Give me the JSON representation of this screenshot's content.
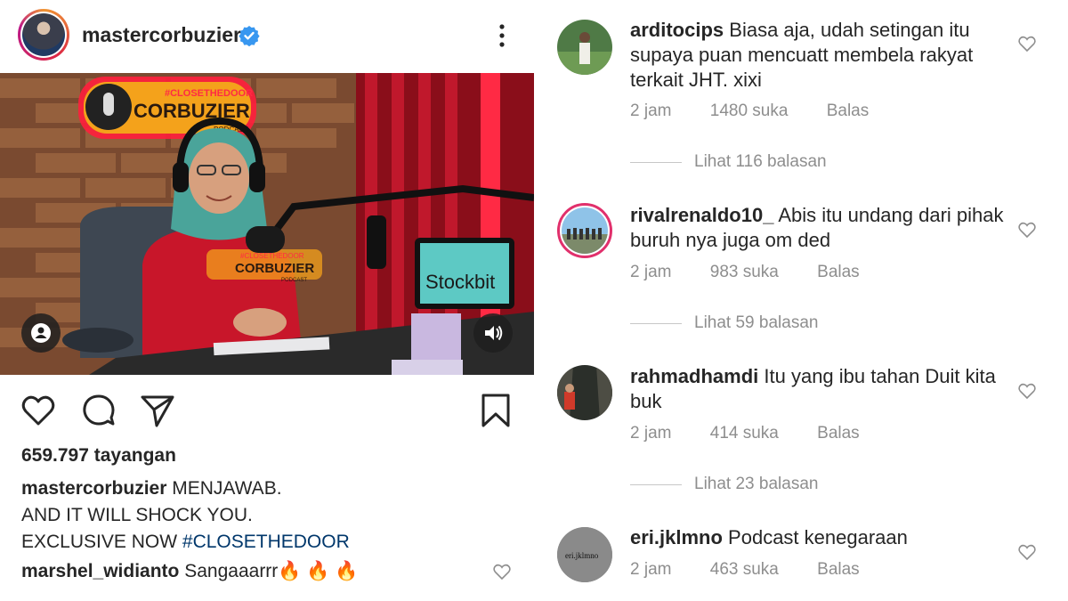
{
  "post": {
    "username": "mastercorbuzier",
    "verified": true,
    "menu_icon": "more-vertical-icon",
    "media": {
      "sign_hashtag": "#CLOSETHEDOOR",
      "sign_title": "CORBUZIER",
      "sign_sub": "PODCAST",
      "shirt_logo_tag": "#CLOSETHEDOOR",
      "shirt_logo_title": "CORBUZIER",
      "shirt_logo_sub": "PODCAST",
      "laptop_brand": "Stockbit"
    },
    "views": "659.797 tayangan",
    "caption": {
      "username": "mastercorbuzier",
      "line1": "MENJAWAB.",
      "line2": "AND IT WILL SHOCK YOU.",
      "line3_text": "EXCLUSIVE NOW",
      "line3_tag": "#CLOSETHEDOOR"
    },
    "preview_comment": {
      "username": "marshel_widianto",
      "text": "Sangaaarrr🔥 🔥 🔥"
    }
  },
  "comments": [
    {
      "username": "arditocips",
      "text": "Biasa aja, udah setingan itu supaya puan mencuatt membela rakyat terkait JHT. xixi",
      "time": "2 jam",
      "likes": "1480 suka",
      "reply": "Balas",
      "view_replies": "Lihat 116 balasan"
    },
    {
      "username": "rivalrenaldo10_",
      "text": "Abis itu undang dari pihak buruh nya juga om ded",
      "time": "2 jam",
      "likes": "983 suka",
      "reply": "Balas",
      "view_replies": "Lihat 59 balasan"
    },
    {
      "username": "rahmadhamdi",
      "text": "Itu yang ibu tahan Duit kita buk",
      "time": "2 jam",
      "likes": "414 suka",
      "reply": "Balas",
      "view_replies": "Lihat 23 balasan"
    },
    {
      "username": "eri.jklmno",
      "text": "Podcast kenegaraan",
      "time": "2 jam",
      "likes": "463 suka",
      "reply": "Balas",
      "avatar_text": "eri.jklmno"
    }
  ],
  "colors": {
    "text": "#262626",
    "muted": "#8e8e8e",
    "verified_blue": "#3897f0",
    "hashtag": "#00376b"
  }
}
